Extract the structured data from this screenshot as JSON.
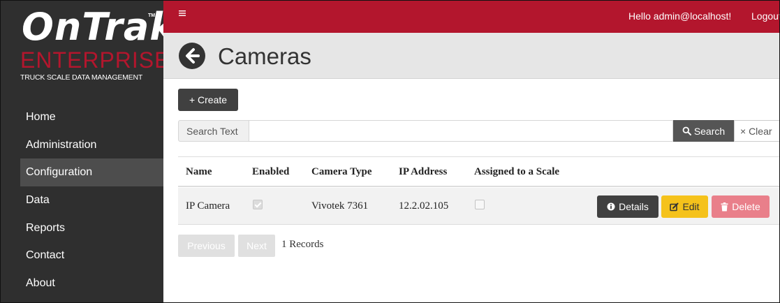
{
  "brand": {
    "name": "OnTrak",
    "trademark": "TM",
    "edition": "ENTERPRISE",
    "tagline": "TRUCK SCALE DATA MANAGEMENT",
    "color": "#b3162d"
  },
  "topbar": {
    "menu_icon": "hamburger-icon",
    "greeting": "Hello admin@localhost!",
    "logout_label": "Logout"
  },
  "sidebar": {
    "items": [
      {
        "label": "Home",
        "active": false
      },
      {
        "label": "Administration",
        "active": false
      },
      {
        "label": "Configuration",
        "active": true
      },
      {
        "label": "Data",
        "active": false
      },
      {
        "label": "Reports",
        "active": false
      },
      {
        "label": "Contact",
        "active": false
      },
      {
        "label": "About",
        "active": false
      }
    ]
  },
  "page": {
    "title": "Cameras",
    "back_icon": "arrow-left-circle-icon"
  },
  "toolbar": {
    "create_label": "+ Create"
  },
  "search": {
    "label": "Search Text",
    "value": "",
    "search_label": "Search",
    "clear_label": "× Clear"
  },
  "table": {
    "columns": [
      "Name",
      "Enabled",
      "Camera Type",
      "IP Address",
      "Assigned to a Scale"
    ],
    "rows": [
      {
        "name": "IP Camera",
        "enabled": true,
        "camera_type": "Vivotek 7361",
        "ip_address": "12.2.02.105",
        "assigned_to_scale": false,
        "actions": {
          "details": "Details",
          "edit": "Edit",
          "delete": "Delete"
        }
      }
    ]
  },
  "pager": {
    "previous_label": "Previous",
    "next_label": "Next",
    "records_text": "1 Records"
  },
  "colors": {
    "topbar": "#b3162d",
    "sidebar": "#2f2f2f",
    "edit": "#f5c21b",
    "delete": "#e97f8a",
    "dark_button": "#404040"
  }
}
